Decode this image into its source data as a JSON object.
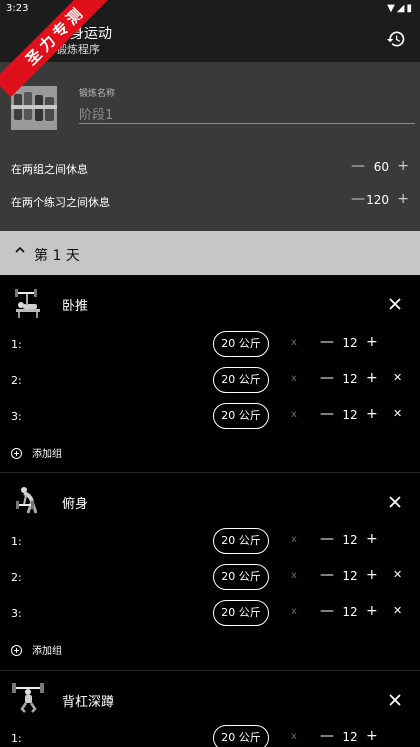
{
  "status": {
    "time": "3:23",
    "icons": "▼◢▮"
  },
  "appbar": {
    "title": "健身运动",
    "subtitle": "锻炼程序",
    "history_icon": "history-icon"
  },
  "banner": "圣力专测",
  "routine": {
    "name_label": "锻炼名称",
    "name_placeholder": "阶段1",
    "rest_between_sets": {
      "label": "在两组之间休息",
      "minus": "—",
      "value": "60",
      "plus": "+"
    },
    "rest_between_exercises": {
      "label": "在两个练习之间休息",
      "minus": "—",
      "value": "120",
      "plus": "+"
    }
  },
  "day": {
    "label": "第 1 天"
  },
  "add_set_label": "添加组",
  "exercises": [
    {
      "name": "卧推",
      "sets": [
        {
          "num": "1:",
          "weight": "20 公斤",
          "x": "x",
          "minus": "—",
          "reps": "12",
          "plus": "+",
          "del": ""
        },
        {
          "num": "2:",
          "weight": "20 公斤",
          "x": "x",
          "minus": "—",
          "reps": "12",
          "plus": "+",
          "del": "✕"
        },
        {
          "num": "3:",
          "weight": "20 公斤",
          "x": "x",
          "minus": "—",
          "reps": "12",
          "plus": "+",
          "del": "✕"
        }
      ]
    },
    {
      "name": "俯身",
      "sets": [
        {
          "num": "1:",
          "weight": "20 公斤",
          "x": "x",
          "minus": "—",
          "reps": "12",
          "plus": "+",
          "del": ""
        },
        {
          "num": "2:",
          "weight": "20 公斤",
          "x": "x",
          "minus": "—",
          "reps": "12",
          "plus": "+",
          "del": "✕"
        },
        {
          "num": "3:",
          "weight": "20 公斤",
          "x": "x",
          "minus": "—",
          "reps": "12",
          "plus": "+",
          "del": "✕"
        }
      ]
    },
    {
      "name": "背杠深蹲",
      "sets": [
        {
          "num": "1:",
          "weight": "20 公斤",
          "x": "x",
          "minus": "—",
          "reps": "12",
          "plus": "+",
          "del": ""
        }
      ]
    }
  ]
}
